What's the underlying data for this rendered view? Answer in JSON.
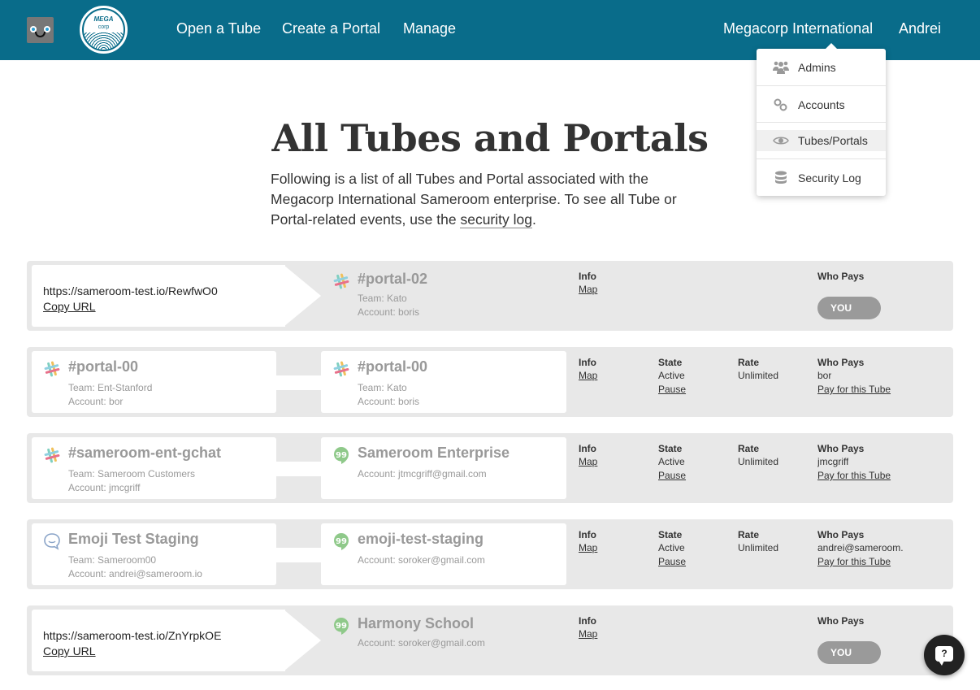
{
  "header": {
    "nav": [
      "Open a Tube",
      "Create a Portal",
      "Manage"
    ],
    "org": "Megacorp International",
    "user": "Andrei",
    "logo_text_1": "MEGA",
    "logo_text_2": "corp"
  },
  "dropdown": {
    "items": [
      {
        "label": "Admins",
        "icon": "users-icon"
      },
      {
        "label": "Accounts",
        "icon": "link-icon"
      },
      {
        "label": "Tubes/Portals",
        "icon": "eye-icon",
        "active": true
      },
      {
        "label": "Security Log",
        "icon": "database-icon"
      }
    ]
  },
  "page": {
    "title": "All Tubes and Portals",
    "intro_before": "Following is a list of all Tubes and Portal associated with the Megacorp International Sameroom enterprise. To see all Tube or Portal-related events, use the ",
    "intro_link": "security log",
    "intro_after": "."
  },
  "labels": {
    "info": "Info",
    "map": "Map",
    "state": "State",
    "rate": "Rate",
    "who_pays": "Who Pays",
    "pause": "Pause",
    "pay_for_tube": "Pay for this Tube",
    "copy_url": "Copy URL",
    "you": "YOU"
  },
  "rows": [
    {
      "type": "portal",
      "url": "https://sameroom-test.io/RewfwO0",
      "right": {
        "service": "slack",
        "name": "#portal-02",
        "team": "Team: Kato",
        "account": "Account: boris"
      }
    },
    {
      "type": "tube",
      "left": {
        "service": "slack",
        "name": "#portal-00",
        "team": "Team: Ent-Stanford",
        "account": "Account: bor"
      },
      "right": {
        "service": "slack",
        "name": "#portal-00",
        "team": "Team: Kato",
        "account": "Account: boris"
      },
      "state": "Active",
      "rate": "Unlimited",
      "payer": "bor"
    },
    {
      "type": "tube",
      "left": {
        "service": "slack",
        "name": "#sameroom-ent-gchat",
        "team": "Team: Sameroom Customers",
        "account": "Account: jmcgriff"
      },
      "right": {
        "service": "hangouts",
        "name": "Sameroom Enterprise",
        "team": "Account: jtmcgriff@gmail.com",
        "account": ""
      },
      "state": "Active",
      "rate": "Unlimited",
      "payer": "jmcgriff"
    },
    {
      "type": "tube",
      "left": {
        "service": "hipchat",
        "name": "Emoji Test Staging",
        "team": "Team: Sameroom00",
        "account": "Account: andrei@sameroom.io"
      },
      "right": {
        "service": "hangouts",
        "name": "emoji-test-staging",
        "team": "Account: soroker@gmail.com",
        "account": ""
      },
      "state": "Active",
      "rate": "Unlimited",
      "payer": "andrei@sameroom.io"
    },
    {
      "type": "portal",
      "url": "https://sameroom-test.io/ZnYrpkOE",
      "right": {
        "service": "hangouts",
        "name": "Harmony School",
        "team": "Account: soroker@gmail.com",
        "account": ""
      }
    }
  ],
  "help": {
    "label": "?"
  }
}
